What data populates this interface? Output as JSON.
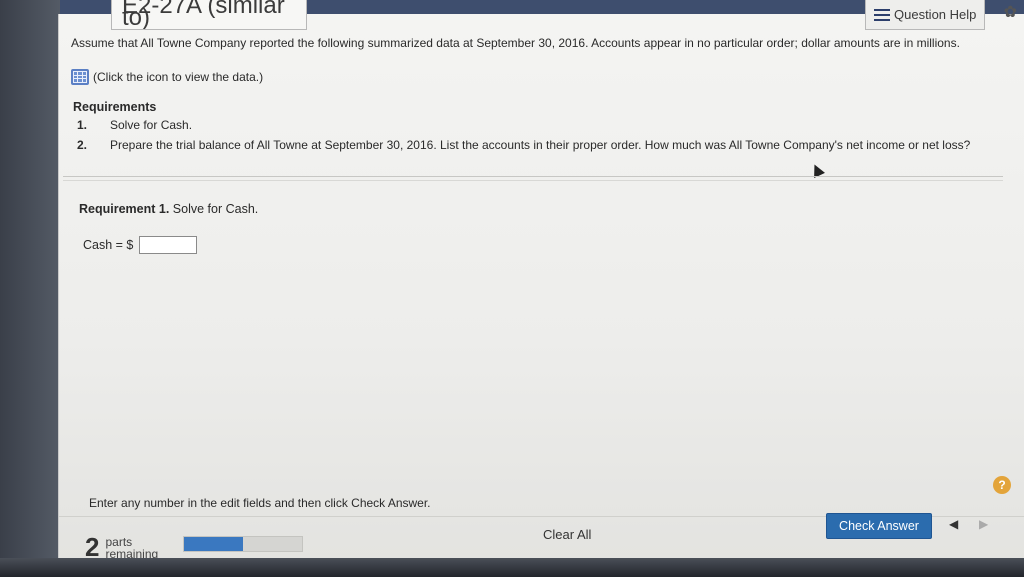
{
  "header": {
    "title": "E2-27A (similar to)",
    "question_help": "Question Help"
  },
  "problem": {
    "intro": "Assume that All Towne Company reported the following summarized data at September 30, 2016. Accounts appear in no particular order; dollar amounts are in millions.",
    "data_link": "(Click the icon to view the data.)"
  },
  "requirements": {
    "heading": "Requirements",
    "items": [
      {
        "num": "1.",
        "text": "Solve for Cash."
      },
      {
        "num": "2.",
        "text": "Prepare the trial balance of All Towne at September 30, 2016. List the accounts in their proper order. How much was All Towne Company's net income or net loss?"
      }
    ]
  },
  "requirement1": {
    "label": "Requirement 1.",
    "text": " Solve for Cash.",
    "cash_label": "Cash = $",
    "cash_value": ""
  },
  "footer": {
    "instructions": "Enter any number in the edit fields and then click Check Answer.",
    "parts_count": "2",
    "parts_label_1": "parts",
    "parts_label_2": "remaining",
    "progress_fraction": 0.5,
    "clear_all": "Clear All",
    "check_answer": "Check Answer",
    "help": "?"
  },
  "colors": {
    "check_answer_bg": "#2b6cae",
    "progress_fill": "#3a78c0",
    "help_circle": "#e3a43a"
  }
}
